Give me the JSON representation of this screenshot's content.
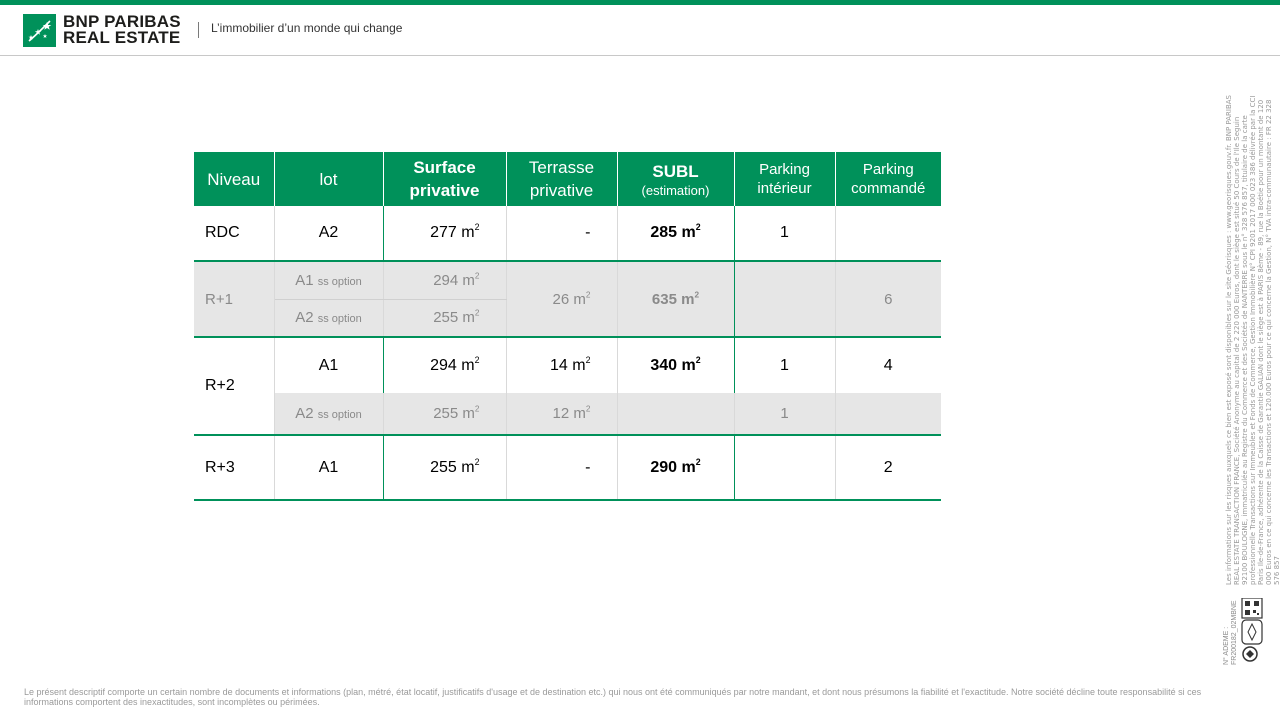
{
  "brand": {
    "line1": "BNP PARIBAS",
    "line2": "REAL ESTATE",
    "tagline": "L’immobilier d’un monde qui change",
    "color": "#00915a"
  },
  "table": {
    "headers": {
      "niveau": "Niveau",
      "lot": "lot",
      "surface_l1": "Surface",
      "surface_l2": "privative",
      "terrasse_l1": "Terrasse",
      "terrasse_l2": "privative",
      "subl": "SUBL",
      "subl_note": "(estimation)",
      "pint_l1": "Parking",
      "pint_l2": "intérieur",
      "pcmd_l1": "Parking",
      "pcmd_l2": "commandé"
    },
    "unit": "m",
    "option_note": "ss option",
    "rows": {
      "rdc": {
        "niveau": "RDC",
        "lot": "A2",
        "surface": "277",
        "terrasse": "-",
        "subl": "285",
        "parking_int": "1",
        "parking_cmd": ""
      },
      "r1": {
        "niveau": "R+1",
        "lot_a": "A1",
        "surface_a": "294",
        "lot_b": "A2",
        "surface_b": "255",
        "terrasse": "26",
        "subl": "635",
        "parking_int": "",
        "parking_cmd": "6"
      },
      "r2": {
        "niveau": "R+2",
        "lot_a": "A1",
        "surface_a": "294",
        "terrasse_a": "14",
        "subl": "340",
        "parking_int_a": "1",
        "parking_cmd": "4",
        "lot_b": "A2",
        "surface_b": "255",
        "terrasse_b": "12",
        "parking_int_b": "1"
      },
      "r3": {
        "niveau": "R+3",
        "lot": "A1",
        "surface": "255",
        "terrasse": "-",
        "subl": "290",
        "parking_int": "",
        "parking_cmd": "2"
      }
    }
  },
  "legal_side": "Les informations sur les risques auxquels ce bien est exposé sont disponibles sur le site Géorisques : www.georisques.gouv.fr. BNP PARIBAS REAL ESTATE TRANSACTION FRANCE, Société Anonyme au capital de 2 220 000 Euros, dont le siège est situé 50 Cours de l'Ile Seguin 92100 BOULOGNE, immatriculée au Registre du Commerce et des Sociétés de NANTERRE sous le n° 328 576 857, titulaire de la carte professionnelle Transactions sur Immeubles et Fonds de Commerce, Gestion Immobilière N° CPI 9201 2017 000 023 386 délivrée par la CCI Paris Ile-de-France, adhérente de la Caisse de Garantie GALIAN dont le siège est à PARIS 8ème - 89, rue la Boétie pour un montant de 120 000 Euros en ce qui concerne les Transactions et 120.000 Euros pour ce qui concerne la Gestion, N° TVA intra-communautaire : FR 22 328 576 857",
  "ademe": "N° ADEME : FR200182_02MBNE",
  "footer": "Le présent descriptif comporte un certain nombre de documents et informations (plan, métré, état locatif, justificatifs d'usage et de destination etc.) qui nous ont été communiqués par notre mandant, et dont nous présumons la fiabilité et l'exactitude. Notre société décline toute responsabilité si ces informations comportent des inexactitudes, sont incomplètes ou périmées."
}
